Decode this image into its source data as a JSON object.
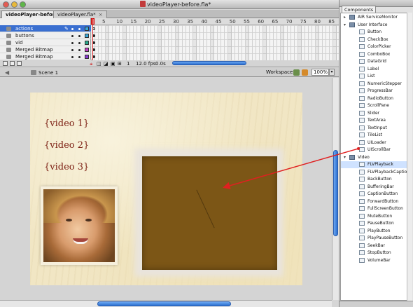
{
  "window": {
    "title": "videoPlayer-before.fla*"
  },
  "doc_tabs": [
    {
      "label": "videoPlayer-before.fla*",
      "active": true
    },
    {
      "label": "videoPlayer.fla*",
      "active": false
    }
  ],
  "timeline": {
    "layers": [
      {
        "name": "actions",
        "selected": true,
        "color": "#3aa6d8"
      },
      {
        "name": "buttons",
        "selected": false,
        "color": "#3aa6d8"
      },
      {
        "name": "vid",
        "selected": false,
        "color": "#2aa88a"
      },
      {
        "name": "Merged Bitmap",
        "selected": false,
        "color": "#c23bc2"
      },
      {
        "name": "Merged Bitmap",
        "selected": false,
        "color": "#8a3bd0"
      }
    ],
    "ruler": [
      "5",
      "10",
      "15",
      "20",
      "25",
      "30",
      "35",
      "40",
      "45",
      "50",
      "55",
      "60",
      "65",
      "70",
      "75",
      "80",
      "85"
    ],
    "current_frame": "1",
    "fps": "12.0 fps",
    "elapsed": "0.0s"
  },
  "editbar": {
    "scene": "Scene 1",
    "workspace": "Workspace",
    "zoom": "100%"
  },
  "stage": {
    "video_labels": [
      "{video 1}",
      "{video 2}",
      "{video 3}"
    ],
    "player_color": "#7c5616"
  },
  "components_panel": {
    "tab": "Components",
    "items": [
      {
        "label": "AIR ServiceMonitor",
        "type": "group",
        "expanded": false
      },
      {
        "label": "User Interface",
        "type": "group",
        "expanded": true
      },
      {
        "label": "Button",
        "type": "item"
      },
      {
        "label": "CheckBox",
        "type": "item"
      },
      {
        "label": "ColorPicker",
        "type": "item"
      },
      {
        "label": "ComboBox",
        "type": "item"
      },
      {
        "label": "DataGrid",
        "type": "item"
      },
      {
        "label": "Label",
        "type": "item"
      },
      {
        "label": "List",
        "type": "item"
      },
      {
        "label": "NumericStepper",
        "type": "item"
      },
      {
        "label": "ProgressBar",
        "type": "item"
      },
      {
        "label": "RadioButton",
        "type": "item"
      },
      {
        "label": "ScrollPane",
        "type": "item"
      },
      {
        "label": "Slider",
        "type": "item"
      },
      {
        "label": "TextArea",
        "type": "item"
      },
      {
        "label": "TextInput",
        "type": "item"
      },
      {
        "label": "TileList",
        "type": "item"
      },
      {
        "label": "UILoader",
        "type": "item"
      },
      {
        "label": "UIScrollBar",
        "type": "item"
      },
      {
        "label": "Video",
        "type": "group",
        "expanded": true
      },
      {
        "label": "FLVPlayback",
        "type": "item",
        "selected": true
      },
      {
        "label": "FLVPlaybackCaptioning",
        "type": "item"
      },
      {
        "label": "BackButton",
        "type": "item"
      },
      {
        "label": "BufferingBar",
        "type": "item"
      },
      {
        "label": "CaptionButton",
        "type": "item"
      },
      {
        "label": "ForwardButton",
        "type": "item"
      },
      {
        "label": "FullScreenButton",
        "type": "item"
      },
      {
        "label": "MuteButton",
        "type": "item"
      },
      {
        "label": "PauseButton",
        "type": "item"
      },
      {
        "label": "PlayButton",
        "type": "item"
      },
      {
        "label": "PlayPauseButton",
        "type": "item"
      },
      {
        "label": "SeekBar",
        "type": "item"
      },
      {
        "label": "StopButton",
        "type": "item"
      },
      {
        "label": "VolumeBar",
        "type": "item"
      }
    ]
  },
  "colors": {
    "accent": "#2c6fd1",
    "drag_arrow": "#e02020"
  }
}
